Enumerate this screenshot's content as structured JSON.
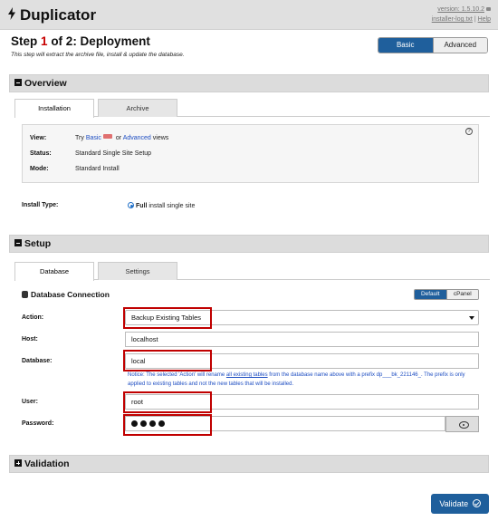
{
  "header": {
    "title": "Duplicator",
    "version": "version: 1.5.10.2",
    "installer_log": "installer-log.txt",
    "separator": "|",
    "help": "Help"
  },
  "step": {
    "prefix": "Step",
    "number": "1",
    "suffix": "of 2: Deployment",
    "subtitle": "This step will extract the archive file, install & update the database."
  },
  "mode_toggle": {
    "basic": "Basic",
    "advanced": "Advanced",
    "selected": "Basic"
  },
  "overview": {
    "title": "Overview",
    "tabs": [
      "Installation",
      "Archive"
    ],
    "view_label": "View:",
    "view_try": "Try",
    "view_basic": "Basic",
    "view_or": "or",
    "view_advanced": "Advanced",
    "view_suffix": "views",
    "status_label": "Status:",
    "status_value": "Standard Single Site Setup",
    "mode_label": "Mode:",
    "mode_value": "Standard Install",
    "install_type_label": "Install Type:",
    "install_type_bold": "Full",
    "install_type_rest": "install single site"
  },
  "setup": {
    "title": "Setup",
    "tabs": [
      "Database",
      "Settings"
    ],
    "db_title": "Database Connection",
    "db_toggle": {
      "default": "Default",
      "cpanel": "cPanel",
      "selected": "Default"
    },
    "action_label": "Action:",
    "action_value": "Backup Existing Tables",
    "host_label": "Host:",
    "host_value": "localhost",
    "database_label": "Database:",
    "database_value": "local",
    "notice_prefix": "Notice: The selected 'Action' will rename",
    "notice_link": "all existing tables",
    "notice_rest": "from the database name above with a prefix dp___bk_221146_. The prefix is only applied to existing tables and not the new tables that will be installed.",
    "user_label": "User:",
    "user_value": "root",
    "password_label": "Password:",
    "password_length": 4
  },
  "validation": {
    "title": "Validation"
  },
  "validate_button": "Validate",
  "colors": {
    "accent": "#1f5f9c",
    "highlight": "#c00000",
    "notice": "#1d4dc2"
  },
  "icons": [
    "bolt-icon",
    "lock-icon",
    "minus-square-icon",
    "plus-square-icon",
    "help-circle-icon",
    "database-icon",
    "eye-icon",
    "check-circle-icon"
  ]
}
